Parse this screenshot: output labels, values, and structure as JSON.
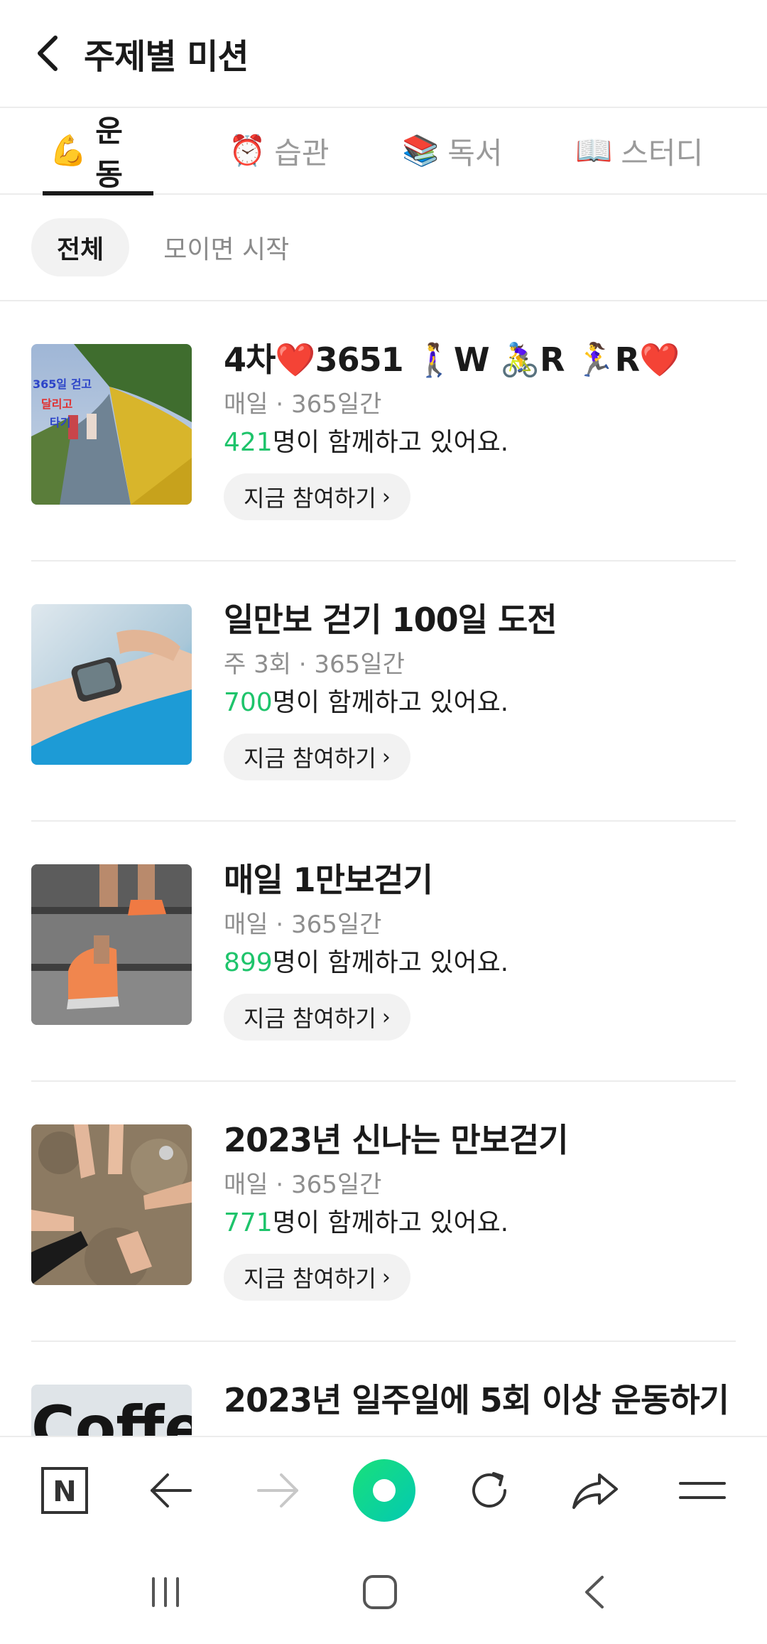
{
  "header": {
    "title": "주제별 미션"
  },
  "tabs": [
    {
      "emoji": "💪",
      "label": "운동",
      "active": true
    },
    {
      "emoji": "⏰",
      "label": "습관",
      "active": false
    },
    {
      "emoji": "📚",
      "label": "독서",
      "active": false
    },
    {
      "emoji": "📖",
      "label": "스터디",
      "active": false
    }
  ],
  "filters": [
    {
      "label": "전체",
      "active": true
    },
    {
      "label": "모이면 시작",
      "active": false
    }
  ],
  "missions": [
    {
      "title": "4차❤️3651 🚶‍♀️W 🚴‍♀️R 🏃‍♀️R❤️",
      "meta": "매일 · 365일간",
      "count": "421",
      "count_suffix": "명이 함께하고 있어요.",
      "join_label": "지금 참여하기",
      "thumb_text": [
        "365일 걷고",
        "달리고",
        "타기"
      ]
    },
    {
      "title": "일만보 걷기 100일 도전",
      "meta": "주 3회 · 365일간",
      "count": "700",
      "count_suffix": "명이 함께하고 있어요.",
      "join_label": "지금 참여하기"
    },
    {
      "title": "매일 1만보걷기",
      "meta": "매일 · 365일간",
      "count": "899",
      "count_suffix": "명이 함께하고 있어요.",
      "join_label": "지금 참여하기"
    },
    {
      "title": "2023년 신나는 만보걷기",
      "meta": "매일 · 365일간",
      "count": "771",
      "count_suffix": "명이 함께하고 있어요.",
      "join_label": "지금 참여하기"
    },
    {
      "title": "2023년 일주일에 5회 이상 운동하기",
      "meta": "",
      "count": "",
      "count_suffix": "",
      "join_label": "",
      "thumb_text": [
        "Coffe"
      ]
    }
  ],
  "toolbar": {
    "icons": [
      "naver-n-icon",
      "back-arrow-icon",
      "forward-arrow-icon",
      "green-dot-home-icon",
      "refresh-icon",
      "share-icon",
      "menu-icon"
    ],
    "naver_letter": "N"
  },
  "colors": {
    "accent_green": "#1ec46b",
    "text_primary": "#1a1a1a",
    "text_secondary": "#8e8e8e",
    "chip_bg": "#f2f2f2"
  }
}
